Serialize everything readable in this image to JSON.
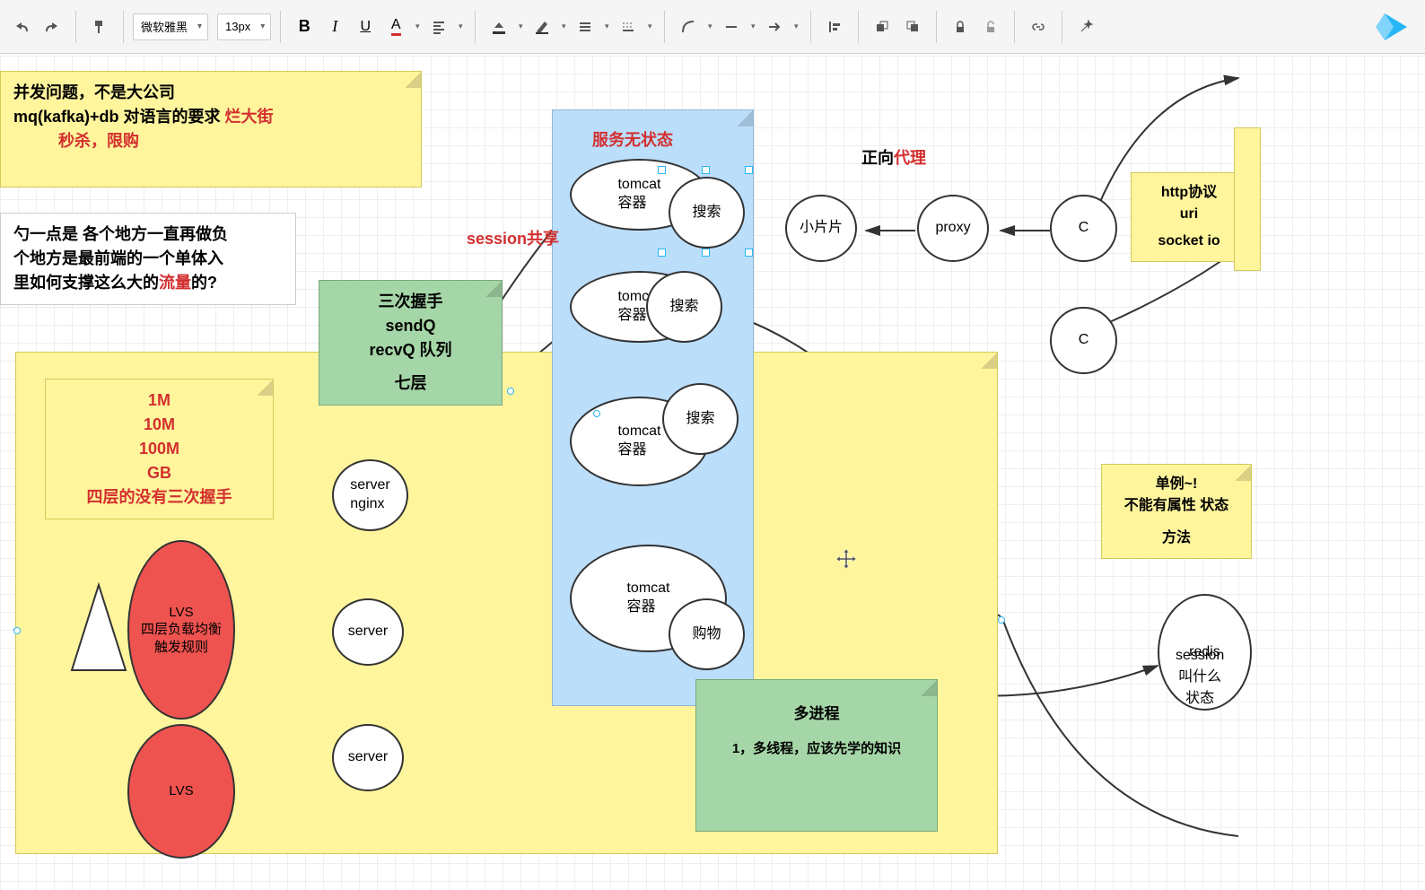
{
  "toolbar": {
    "font": "微软雅黑",
    "size": "13px"
  },
  "notes": {
    "top_yellow": {
      "line1_black": "并发问题，不是大公司",
      "line2_black": "mq(kafka)+db 对语言的要求",
      "line2_red": "烂大街",
      "line3_red": "秒杀，限购"
    },
    "white_left": {
      "line1": "勺一点是 各个地方一直再做负",
      "line2": "个地方是最前端的一个单体入",
      "line3_a": "里如何支撑这么大的",
      "line3_b": "流量",
      "line3_c": "的?"
    },
    "green_handshake": {
      "l1": "三次握手",
      "l2": "sendQ",
      "l3": "recvQ  队列",
      "l4": "七层"
    },
    "yellow_layers": {
      "l1": "1M",
      "l2": "10M",
      "l3": "100M",
      "l4": "GB",
      "l5": "四层的没有三次握手"
    },
    "green_bottom": {
      "l1": "多进程",
      "l2": "1，多线程，应该先学的知识"
    },
    "yellow_singleton": {
      "l1": "单例~!",
      "l2": "不能有属性  状态",
      "l3": "方法"
    },
    "yellow_http": {
      "l1": "http协议",
      "l2": "uri",
      "l3": "socket io"
    }
  },
  "labels": {
    "service_stateless": "服务无状态",
    "session_share": "session共享",
    "forward": "正向",
    "proxy_cn": "代理"
  },
  "nodes": {
    "tomcat": "tomcat\n容器",
    "search": "搜索",
    "shopping": "购物",
    "server_nginx": "server\nnginx",
    "server": "server",
    "lvs": "LVS\n四层负载均衡\n触发规则",
    "lvs2": "LVS",
    "pieces": "小片片",
    "proxy": "proxy",
    "c": "C",
    "redis": "redis",
    "session_state": "session\n叫什么\n状态"
  }
}
